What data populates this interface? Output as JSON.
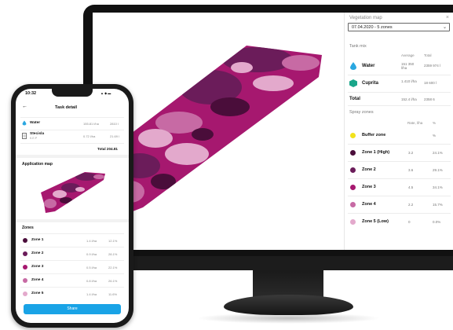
{
  "desktop": {
    "panel_title": "Vegetation map",
    "date_select": "07.04.2020 - 5 zones",
    "tank_mix_label": "Tank mix",
    "tank_mix_columns": {
      "average": "Average",
      "total": "Total"
    },
    "tank_mix": [
      {
        "name": "Water",
        "icon": "water-drop-icon",
        "color": "#2aa7e0",
        "average": "151 350 l/ha",
        "total": "2359 974 l"
      },
      {
        "name": "Cuprita",
        "icon": "product-box-icon",
        "color": "#1aa68a",
        "average": "1.410 l/ha",
        "total": "18 600 l"
      }
    ],
    "total_label": "Total",
    "total_average": "152.4 l/ha",
    "total_total": "2358 6",
    "spray_zones_label": "Spray zones",
    "zone_columns": {
      "rate": "Rate, l/ha",
      "pct": "%"
    },
    "zones": [
      {
        "name": "Buffer zone",
        "color": "#f2e21b",
        "rate": "",
        "pct": "%"
      },
      {
        "name": "Zone 1 (High)",
        "color": "#4a0d3a",
        "rate": "3.2",
        "pct": "24.1%"
      },
      {
        "name": "Zone 2",
        "color": "#6b1c5a",
        "rate": "3.6",
        "pct": "29.1%"
      },
      {
        "name": "Zone 3",
        "color": "#a6186f",
        "rate": "4.5",
        "pct": "34.1%"
      },
      {
        "name": "Zone 4",
        "color": "#c76aa4",
        "rate": "2.2",
        "pct": "15.7%"
      },
      {
        "name": "Zone 5 (Low)",
        "color": "#e3a9cc",
        "rate": "0",
        "pct": "0.0%"
      }
    ]
  },
  "phone": {
    "time": "10:32",
    "status_icons": "▲ ◆ ▬",
    "title": "Task detail",
    "tank": [
      {
        "name": "Water",
        "sub": "",
        "rate": "155.81 l/ha",
        "total": "2810 l",
        "icon": "water-drop-icon",
        "color": "#2aa7e0"
      },
      {
        "name": "Stecisla",
        "sub": "K.E.P",
        "rate": "0.72 l/ha",
        "total": "21.69 l",
        "icon": "product-doc-icon",
        "color": "#555555"
      }
    ],
    "total_text": "Total 204.81",
    "application_map_label": "Application map",
    "zones_label": "Zones",
    "zones": [
      {
        "name": "Zone 1",
        "color": "#4a0d3a",
        "rate": "1.4 l/ha",
        "pct": "12.1%"
      },
      {
        "name": "Zone 2",
        "color": "#6b1c5a",
        "rate": "0.9 l/ha",
        "pct": "28.1%"
      },
      {
        "name": "Zone 3",
        "color": "#a6186f",
        "rate": "0.5 l/ha",
        "pct": "22.1%"
      },
      {
        "name": "Zone 4",
        "color": "#c76aa4",
        "rate": "0.8 l/ha",
        "pct": "26.1%"
      },
      {
        "name": "Zone 5",
        "color": "#e3a9cc",
        "rate": "1.4 l/ha",
        "pct": "11.6%"
      }
    ],
    "share_label": "Share"
  }
}
